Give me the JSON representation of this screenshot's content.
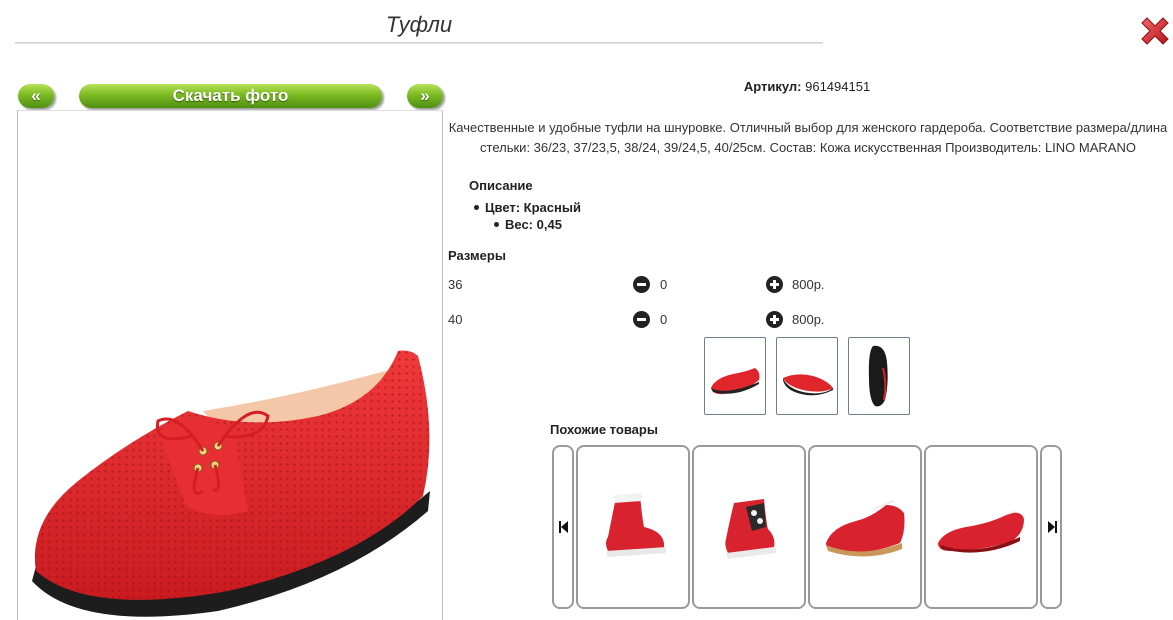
{
  "header": {
    "title": "Туфли"
  },
  "gallery": {
    "prev_label": "«",
    "download_label": "Скачать фото",
    "next_label": "»"
  },
  "product": {
    "article_label": "Артикул:",
    "article_value": "961494151",
    "description": "Качественные и удобные туфли на шнуровке. Отличный выбор для женского гардероба. Соответствие размера/длина стельки: 36/23, 37/23,5, 38/24, 39/24,5, 40/25см. Состав: Кожа искусственная Производитель: LINO MARANO",
    "features_heading": "Описание",
    "features": [
      "Цвет: Красный",
      "Вес: 0,45"
    ]
  },
  "sizes": {
    "heading": "Размеры",
    "rows": [
      {
        "size": "36",
        "qty": "0",
        "price": "800р."
      },
      {
        "size": "40",
        "qty": "0",
        "price": "800р."
      }
    ]
  },
  "similar": {
    "heading": "Похожие товары"
  },
  "colors": {
    "accent_green": "#7cba22",
    "close_red": "#d8202a",
    "shoe_red": "#e0262b"
  }
}
